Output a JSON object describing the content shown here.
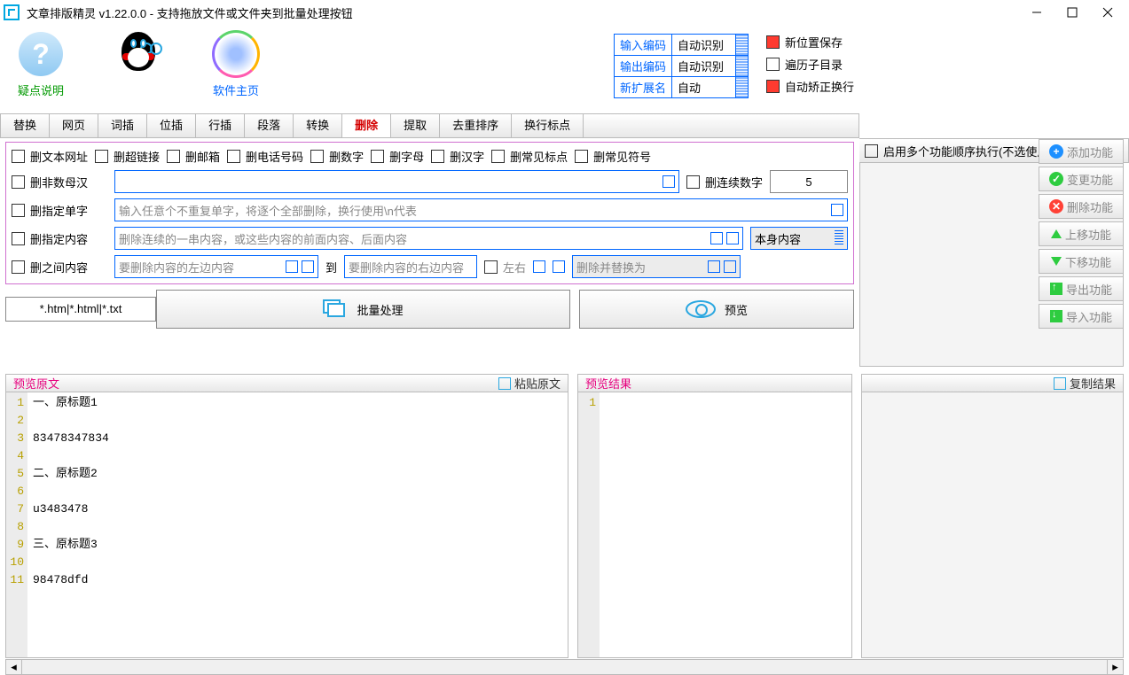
{
  "window": {
    "title": "文章排版精灵 v1.22.0.0 - 支持拖放文件或文件夹到批量处理按钮"
  },
  "header": {
    "help": "疑点说明",
    "home": "软件主页",
    "encoding": {
      "input_lbl": "输入编码",
      "input_val": "自动识别",
      "output_lbl": "输出编码",
      "output_val": "自动识别",
      "ext_lbl": "新扩展名",
      "ext_val": "自动"
    },
    "rightchecks": {
      "newpos": "新位置保存",
      "recurse": "遍历子目录",
      "autowrap": "自动矫正换行"
    }
  },
  "tabs": [
    "替换",
    "网页",
    "词插",
    "位插",
    "行插",
    "段落",
    "转换",
    "删除",
    "提取",
    "去重排序",
    "换行标点"
  ],
  "active_tab_index": 7,
  "enable_label": "启用多个功能顺序执行(不选使用当前功能)",
  "del": {
    "row1": [
      "删文本网址",
      "删超链接",
      "删邮箱",
      "删电话号码",
      "删数字",
      "删字母",
      "删汉字",
      "删常见标点",
      "删常见符号"
    ],
    "nonnumhan": "删非数母汉",
    "contnum": "删连续数字",
    "contnum_val": "5",
    "word": "删指定单字",
    "word_ph": "输入任意个不重复单字，将逐个全部删除，换行使用\\n代表",
    "content": "删指定内容",
    "content_ph": "删除连续的一串内容，或这些内容的前面内容、后面内容",
    "content_mode": "本身内容",
    "between": "删之间内容",
    "left_ph": "要删除内容的左边内容",
    "to": "到",
    "right_ph": "要删除内容的右边内容",
    "lr": "左右",
    "replace": "删除并替换为"
  },
  "mid": {
    "filetype": "*.htm|*.html|*.txt",
    "batch": "批量处理",
    "preview": "预览"
  },
  "sidebar": [
    "添加功能",
    "变更功能",
    "删除功能",
    "上移功能",
    "下移功能",
    "导出功能",
    "导入功能"
  ],
  "preview": {
    "left_title": "预览原文",
    "paste": "粘贴原文",
    "right_title": "预览结果",
    "copy": "复制结果"
  },
  "source_lines": [
    "一、原标题1",
    "",
    "83478347834",
    "",
    "二、原标题2",
    "",
    "u3483478",
    "",
    "三、原标题3",
    "",
    "98478dfd"
  ]
}
